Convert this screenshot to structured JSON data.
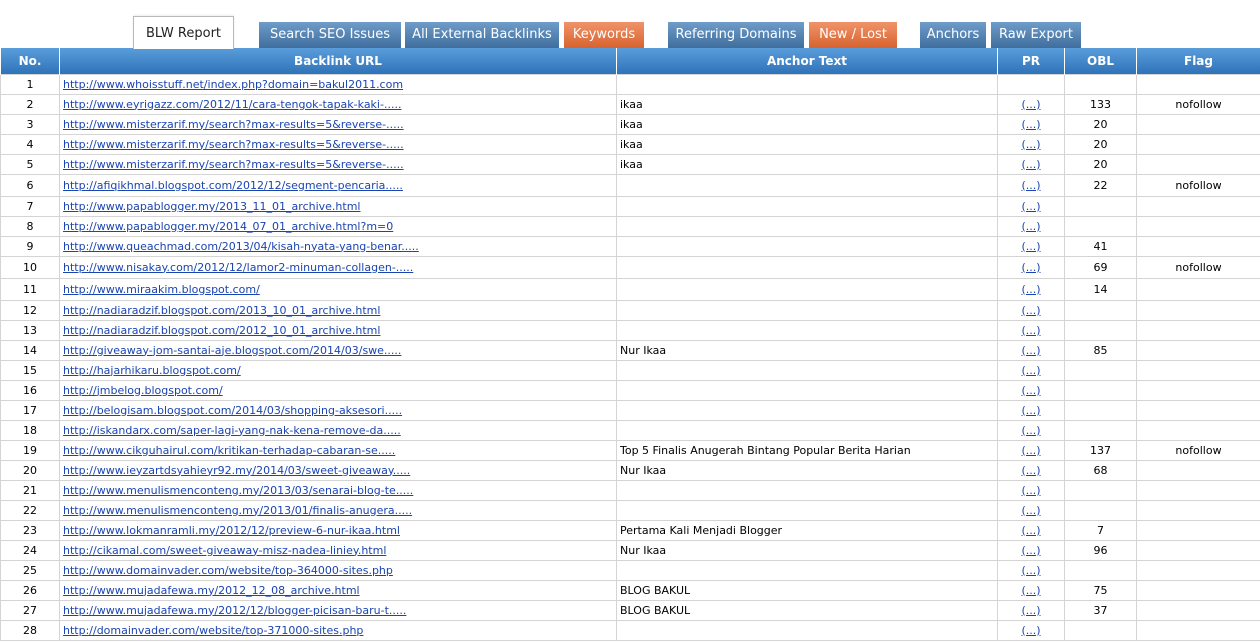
{
  "tabs": [
    {
      "label": "BLW Report",
      "style": "active"
    },
    {
      "label": "Search SEO Issues",
      "style": "blue"
    },
    {
      "label": "All External Backlinks",
      "style": "blue"
    },
    {
      "label": "Keywords",
      "style": "orange"
    },
    {
      "label": "Referring Domains",
      "style": "blue"
    },
    {
      "label": "New / Lost",
      "style": "orange"
    },
    {
      "label": "Anchors",
      "style": "blue"
    },
    {
      "label": "Raw Export",
      "style": "blue"
    }
  ],
  "table": {
    "headers": [
      "No.",
      "Backlink URL",
      "Anchor Text",
      "PR",
      "OBL",
      "Flag"
    ],
    "pr_link": "(...)",
    "rows": [
      {
        "no": "1",
        "url": "http://www.whoisstuff.net/index.php?domain=bakul2011.com",
        "anchor": "",
        "pr": "",
        "obl": "",
        "flag": ""
      },
      {
        "no": "2",
        "url": "http://www.eyrigazz.com/2012/11/cara-tengok-tapak-kaki-.....",
        "anchor": "ikaa",
        "pr": "(...)",
        "obl": "133",
        "flag": "nofollow"
      },
      {
        "no": "3",
        "url": "http://www.misterzarif.my/search?max-results=5&reverse-.....",
        "anchor": "ikaa",
        "pr": "(...)",
        "obl": "20",
        "flag": ""
      },
      {
        "no": "4",
        "url": "http://www.misterzarif.my/search?max-results=5&reverse-.....",
        "anchor": "ikaa",
        "pr": "(...)",
        "obl": "20",
        "flag": ""
      },
      {
        "no": "5",
        "url": "http://www.misterzarif.my/search?max-results=5&reverse-.....",
        "anchor": "ikaa",
        "pr": "(...)",
        "obl": "20",
        "flag": ""
      },
      {
        "no": "6",
        "url": "http://afiqikhmal.blogspot.com/2012/12/segment-pencaria.....",
        "anchor": "",
        "pr": "(...)",
        "obl": "22",
        "flag": "nofollow"
      },
      {
        "no": "7",
        "url": "http://www.papablogger.my/2013_11_01_archive.html",
        "anchor": "",
        "pr": "(...)",
        "obl": "",
        "flag": ""
      },
      {
        "no": "8",
        "url": "http://www.papablogger.my/2014_07_01_archive.html?m=0",
        "anchor": "",
        "pr": "(...)",
        "obl": "",
        "flag": ""
      },
      {
        "no": "9",
        "url": "http://www.queachmad.com/2013/04/kisah-nyata-yang-benar.....",
        "anchor": "",
        "pr": "(...)",
        "obl": "41",
        "flag": ""
      },
      {
        "no": "10",
        "url": "http://www.nisakay.com/2012/12/lamor2-minuman-collagen-.....",
        "anchor": "",
        "pr": "(...)",
        "obl": "69",
        "flag": "nofollow"
      },
      {
        "no": "11",
        "url": "http://www.miraakim.blogspot.com/",
        "anchor": "",
        "pr": "(...)",
        "obl": "14",
        "flag": ""
      },
      {
        "no": "12",
        "url": "http://nadiaradzif.blogspot.com/2013_10_01_archive.html",
        "anchor": "",
        "pr": "(...)",
        "obl": "",
        "flag": ""
      },
      {
        "no": "13",
        "url": "http://nadiaradzif.blogspot.com/2012_10_01_archive.html",
        "anchor": "",
        "pr": "(...)",
        "obl": "",
        "flag": ""
      },
      {
        "no": "14",
        "url": "http://giveaway-jom-santai-aje.blogspot.com/2014/03/swe.....",
        "anchor": "Nur Ikaa",
        "pr": "(...)",
        "obl": "85",
        "flag": ""
      },
      {
        "no": "15",
        "url": "http://hajarhikaru.blogspot.com/",
        "anchor": "",
        "pr": "(...)",
        "obl": "",
        "flag": ""
      },
      {
        "no": "16",
        "url": "http://jmbelog.blogspot.com/",
        "anchor": "",
        "pr": "(...)",
        "obl": "",
        "flag": ""
      },
      {
        "no": "17",
        "url": "http://belogisam.blogspot.com/2014/03/shopping-aksesori.....",
        "anchor": "",
        "pr": "(...)",
        "obl": "",
        "flag": ""
      },
      {
        "no": "18",
        "url": "http://iskandarx.com/saper-lagi-yang-nak-kena-remove-da.....",
        "anchor": "",
        "pr": "(...)",
        "obl": "",
        "flag": ""
      },
      {
        "no": "19",
        "url": "http://www.cikguhairul.com/kritikan-terhadap-cabaran-se.....",
        "anchor": "Top 5 Finalis Anugerah Bintang Popular Berita Harian",
        "pr": "(...)",
        "obl": "137",
        "flag": "nofollow"
      },
      {
        "no": "20",
        "url": "http://www.ieyzartdsyahieyr92.my/2014/03/sweet-giveaway.....",
        "anchor": "Nur Ikaa",
        "pr": "(...)",
        "obl": "68",
        "flag": ""
      },
      {
        "no": "21",
        "url": "http://www.menulismenconteng.my/2013/03/senarai-blog-te.....",
        "anchor": "",
        "pr": "(...)",
        "obl": "",
        "flag": ""
      },
      {
        "no": "22",
        "url": "http://www.menulismenconteng.my/2013/01/finalis-anugera.....",
        "anchor": "",
        "pr": "(...)",
        "obl": "",
        "flag": ""
      },
      {
        "no": "23",
        "url": "http://www.lokmanramli.my/2012/12/preview-6-nur-ikaa.html",
        "anchor": "Pertama Kali Menjadi Blogger",
        "pr": "(...)",
        "obl": "7",
        "flag": ""
      },
      {
        "no": "24",
        "url": "http://cikamal.com/sweet-giveaway-misz-nadea-liniey.html",
        "anchor": "Nur Ikaa",
        "pr": "(...)",
        "obl": "96",
        "flag": ""
      },
      {
        "no": "25",
        "url": "http://www.domainvader.com/website/top-364000-sites.php",
        "anchor": "",
        "pr": "(...)",
        "obl": "",
        "flag": ""
      },
      {
        "no": "26",
        "url": "http://www.mujadafewa.my/2012_12_08_archive.html",
        "anchor": "BLOG BAKUL",
        "pr": "(...)",
        "obl": "75",
        "flag": ""
      },
      {
        "no": "27",
        "url": "http://www.mujadafewa.my/2012/12/blogger-picisan-baru-t.....",
        "anchor": "BLOG BAKUL",
        "pr": "(...)",
        "obl": "37",
        "flag": ""
      },
      {
        "no": "28",
        "url": "http://domainvader.com/website/top-371000-sites.php",
        "anchor": "",
        "pr": "(...)",
        "obl": "",
        "flag": ""
      }
    ]
  }
}
